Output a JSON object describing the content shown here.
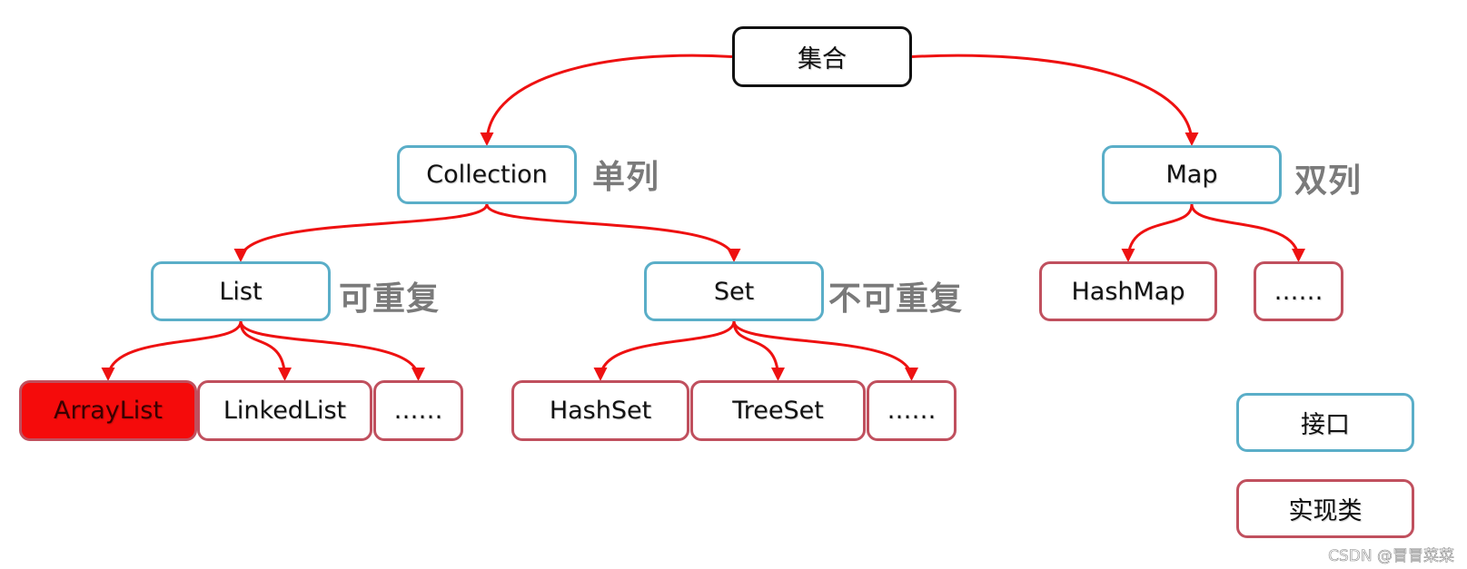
{
  "colors": {
    "edge": "#ee1111",
    "interface_border": "#5aaec8",
    "impl_border": "#c0505e",
    "root_border": "#111111",
    "highlight_fill": "#f50b0b",
    "note_text": "#7a7a7a"
  },
  "nodes": {
    "root": {
      "label": "集合"
    },
    "collection": {
      "label": "Collection",
      "note": "单列"
    },
    "map": {
      "label": "Map",
      "note": "双列"
    },
    "list": {
      "label": "List",
      "note": "可重复"
    },
    "set": {
      "label": "Set",
      "note": "不可重复"
    },
    "arraylist": {
      "label": "ArrayList"
    },
    "linkedlist": {
      "label": "LinkedList"
    },
    "list_more": {
      "label": "……"
    },
    "hashset": {
      "label": "HashSet"
    },
    "treeset": {
      "label": "TreeSet"
    },
    "set_more": {
      "label": "……"
    },
    "hashmap": {
      "label": "HashMap"
    },
    "map_more": {
      "label": "……"
    }
  },
  "edges": [
    [
      "root",
      "collection"
    ],
    [
      "root",
      "map"
    ],
    [
      "collection",
      "list"
    ],
    [
      "collection",
      "set"
    ],
    [
      "list",
      "arraylist"
    ],
    [
      "list",
      "linkedlist"
    ],
    [
      "list",
      "list_more"
    ],
    [
      "set",
      "hashset"
    ],
    [
      "set",
      "treeset"
    ],
    [
      "set",
      "set_more"
    ],
    [
      "map",
      "hashmap"
    ],
    [
      "map",
      "map_more"
    ]
  ],
  "legend": {
    "interface": "接口",
    "implementation": "实现类"
  },
  "watermark": "CSDN @冒冒菜菜"
}
